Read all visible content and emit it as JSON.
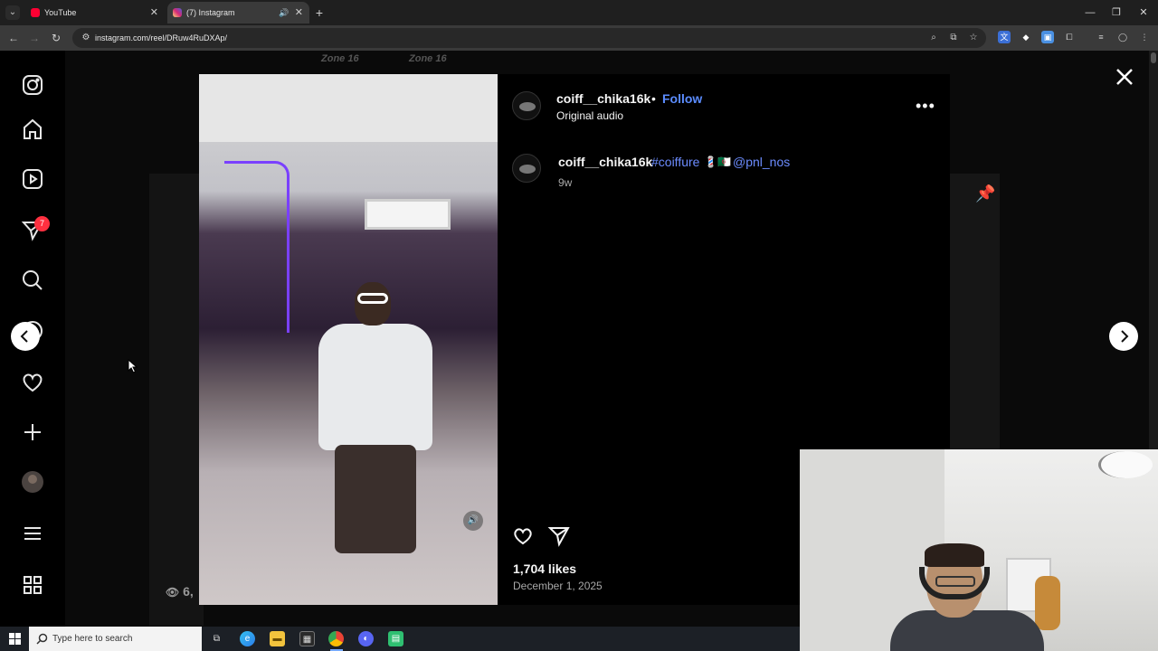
{
  "browser": {
    "tabs": [
      {
        "title": "YouTube",
        "active": false,
        "favicon_color": "#ff0033"
      },
      {
        "title": "(7) Instagram",
        "active": true,
        "favicon_color": "#e1306c"
      }
    ],
    "url": "instagram.com/reel/DRuw4RuDXAp/"
  },
  "background": {
    "words": [
      "Zone 16",
      "Zone 16"
    ],
    "count_text": "6,"
  },
  "sidebar": {
    "notification_count": "7"
  },
  "post": {
    "username": "coiff__chika16k",
    "separator": "•",
    "follow_label": "Follow",
    "audio": "Original audio",
    "caption": {
      "username": "coiff__chika16k",
      "hashtag": "#coiffure",
      "symbols": "💈🇩🇿",
      "mention": "@pnl_nos"
    },
    "time_ago": "9w",
    "likes": "1,704 likes",
    "date": "December 1, 2025"
  },
  "taskbar": {
    "search_placeholder": "Type here to search"
  }
}
